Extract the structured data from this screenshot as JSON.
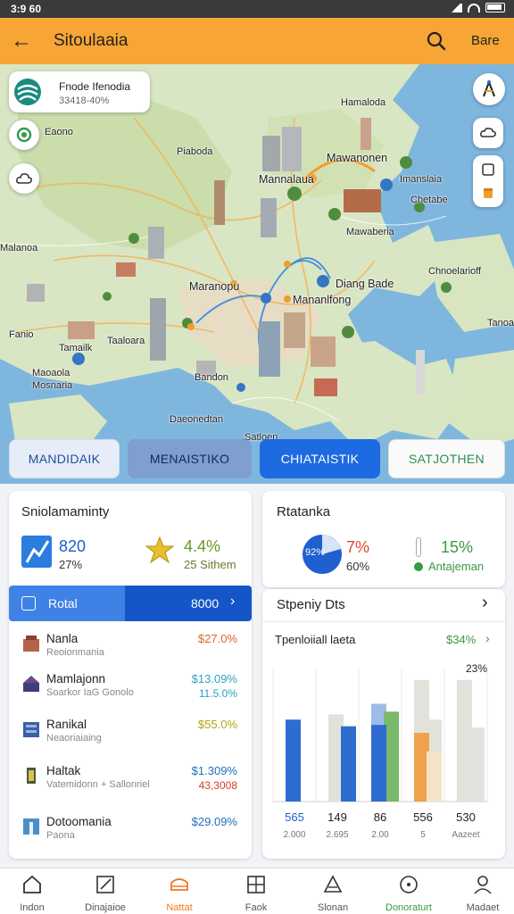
{
  "status": {
    "time": "3:9 60"
  },
  "appbar": {
    "title": "Sitoulaaia",
    "action": "Bare",
    "back_icon": "arrow-left-icon",
    "search_icon": "search-icon"
  },
  "map": {
    "info_card": {
      "title": "Fnode Ifenodia",
      "subtitle": "33418-40%"
    },
    "labels": {
      "l1": "Eaono",
      "l2": "Piaboda",
      "l3": "Hamaloda",
      "l4": "Mannalaua",
      "l5": "Mawanonen",
      "l6": "Imanslaia",
      "l7": "Mawaberia",
      "l8": "Chnoelarioff",
      "l9": "Maranopu",
      "l10": "Diang Bade",
      "l11": "Mananlfong",
      "l12": "Malanoa",
      "l13": "Fanio",
      "l14": "Tamailk",
      "l15": "Taaloara",
      "l16": "Maoaola",
      "l17": "Mosnaria",
      "l18": "Daeonedtan",
      "l19": "Satloen",
      "l20": "Chetabe",
      "l21": "Bandon",
      "l22": "Tanoa"
    }
  },
  "tabs": [
    {
      "label": "MANDIDAIK",
      "state": "light"
    },
    {
      "label": "MENAISTIKO",
      "state": "medium"
    },
    {
      "label": "CHIATAISTIK",
      "state": "active"
    },
    {
      "label": "SATJOTHEN",
      "state": "outline"
    }
  ],
  "left_panel": {
    "title": "Sniolamaminty",
    "stat1": {
      "value": "820",
      "sub": "27%"
    },
    "stat2": {
      "value": "4.4%",
      "sub": "25 Sithem"
    },
    "total_bar": {
      "label": "Rotal",
      "value": "8000"
    },
    "rows": [
      {
        "name": "Nanla",
        "sub": "Reoionmania",
        "v1": "$27.0%",
        "v2": "",
        "v1_color": "#e0632a"
      },
      {
        "name": "Mamlajonn",
        "sub": "Soarkor IaG Gonolo",
        "v1": "$13.09%",
        "v2": "11.5.0%",
        "v1_color": "#2aa3c4"
      },
      {
        "name": "Ranikal",
        "sub": "Neaoriaiaing",
        "v1": "$55.0%",
        "v2": "",
        "v1_color": "#b5a316"
      },
      {
        "name": "Haltak",
        "sub": "Vatemidonn + Sallonriel",
        "v1": "$1.309%",
        "v2": "43,3008",
        "v1_color": "#1f6fb7"
      },
      {
        "name": "Dotoomania",
        "sub": "Paona",
        "v1": "$29.09%",
        "v2": "",
        "v1_color": "#1f6fb7"
      }
    ]
  },
  "right_panel": {
    "title": "Rtatanka",
    "donut_label": "92%",
    "stat1": {
      "value": "7%",
      "sub": "60%"
    },
    "stat2": {
      "value": "15%",
      "sub": "Antajeman"
    },
    "section_title": "Stpeniy Dts",
    "chart_title": "Tpenloiiall laeta",
    "chart_badge": "$34%",
    "colors": {
      "blue": "#2f6cd0",
      "lightblue": "#9dbde9",
      "green": "#7ab86a",
      "orange": "#efa24b",
      "grey": "#e2e2dc",
      "tan": "#f2e4c6"
    }
  },
  "chart_data": {
    "type": "bar",
    "title": "Tpenloiiall laeta",
    "categories": [
      "565",
      "149",
      "86",
      "556",
      "530"
    ],
    "category_sub": [
      "2.000",
      "2.695",
      "2.00",
      "5",
      "Aazeet"
    ],
    "top_label": "23%",
    "series": [
      {
        "values": [
          62,
          66,
          68,
          62,
          0
        ]
      },
      {
        "values": [
          0,
          57,
          58,
          52,
          22
        ]
      },
      {
        "values": [
          0,
          0,
          74,
          38,
          56
        ]
      },
      {
        "values": [
          0,
          0,
          0,
          92,
          92
        ]
      }
    ],
    "ylim": [
      0,
      100
    ]
  },
  "bottom_nav": [
    {
      "label": "Indon",
      "icon": "home-icon"
    },
    {
      "label": "Dinajaioe",
      "icon": "edit-icon"
    },
    {
      "label": "Nattat",
      "icon": "tray-icon",
      "active": true
    },
    {
      "label": "Faok",
      "icon": "grid-icon"
    },
    {
      "label": "Slonan",
      "icon": "triangle-icon"
    },
    {
      "label": "Donoraturt",
      "icon": "compass-icon"
    },
    {
      "label": "Madaet",
      "icon": "person-icon"
    }
  ]
}
